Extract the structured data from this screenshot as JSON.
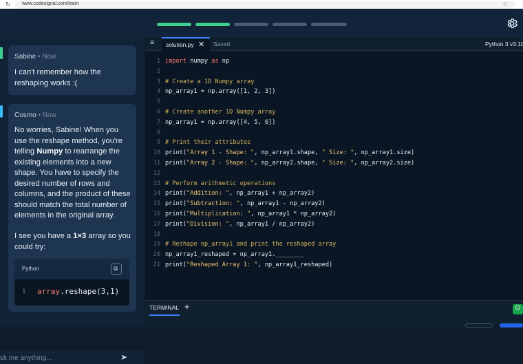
{
  "browser": {
    "url": "www.codesignal.com/learn",
    "reload_icon": "reload-icon",
    "star_icon": "star-icon"
  },
  "header": {
    "progress_segments": [
      {
        "state": "done",
        "color": "#3ecf8e"
      },
      {
        "state": "done",
        "color": "#3ecf8e"
      },
      {
        "state": "todo",
        "color": "#4a5d75"
      },
      {
        "state": "todo",
        "color": "#4a5d75"
      },
      {
        "state": "todo",
        "color": "#4a5d75"
      }
    ],
    "settings_icon": "gear-icon"
  },
  "chat": {
    "messages": [
      {
        "author": "Sabine",
        "sep": "•",
        "time": "Now",
        "accent": "#3ecf8e",
        "text": "I can't remember how the reshaping works :("
      },
      {
        "author": "Cosmo",
        "sep": "•",
        "time": "Now",
        "accent": "#38bdf8",
        "p1_a": "No worries, Sabine! When you use the reshape method, you're telling ",
        "p1_b": "Numpy",
        "p1_c": " to rearrange the existing elements into a new shape. You have to specify the desired number of rows and columns, and the product of these should match the total number of elements in the original array.",
        "p2_a": "I see you have a ",
        "p2_b": "1×3",
        "p2_c": " array so you could try:",
        "code_lang": "Python",
        "code_line_no": "1",
        "code_obj": "array",
        "code_rest": ".reshape(3,1)"
      }
    ],
    "input_placeholder": "sk me anything...",
    "send_icon": "send-icon"
  },
  "editor": {
    "menu_icon": "hamburger-icon",
    "tab_name": "solution.py",
    "close_icon": "close-icon",
    "status": "Saved",
    "language": "Python 3 v3.10",
    "lines": [
      {
        "no": "1",
        "kind": "import",
        "a": "import",
        "b": " numpy ",
        "c": "as",
        "d": " np"
      },
      {
        "no": "2",
        "kind": "blank"
      },
      {
        "no": "3",
        "kind": "comment",
        "text": "# Create a 1D Numpy array"
      },
      {
        "no": "4",
        "kind": "plain",
        "text": "np_array1 = np.array([1, 2, 3])"
      },
      {
        "no": "5",
        "kind": "blank"
      },
      {
        "no": "6",
        "kind": "comment",
        "text": "# Create another 1D Numpy array"
      },
      {
        "no": "7",
        "kind": "plain",
        "text": "np_array1 = np.array([4, 5, 6])"
      },
      {
        "no": "8",
        "kind": "blank"
      },
      {
        "no": "9",
        "kind": "comment",
        "text": "# Print their attributes"
      },
      {
        "no": "10",
        "kind": "print",
        "s": "\"Array 1 - Shape: \"",
        "m": ", np_array1.shape, ",
        "s2": "\" Size: \"",
        "e": ", np_array1.size)"
      },
      {
        "no": "11",
        "kind": "print",
        "s": "\"Array 2 - Shape: \"",
        "m": ", np_array2.shape, ",
        "s2": "\" Size: \"",
        "e": ", np_array2.size)"
      },
      {
        "no": "12",
        "kind": "blank"
      },
      {
        "no": "13",
        "kind": "comment",
        "text": "# Perform arithmetic operations"
      },
      {
        "no": "14",
        "kind": "print",
        "s": "\"Addition: \"",
        "m": ", np_array1 + np_array2)",
        "s2": "",
        "e": ""
      },
      {
        "no": "15",
        "kind": "print",
        "s": "\"Subtraction: \"",
        "m": ", np_array1 - np_array2)",
        "s2": "",
        "e": ""
      },
      {
        "no": "16",
        "kind": "print",
        "s": "\"Multiplication: \"",
        "m": ", np_array1 * np_array2)",
        "s2": "",
        "e": ""
      },
      {
        "no": "17",
        "kind": "print",
        "s": "\"Division: \"",
        "m": ", np_array1 / np_array2)",
        "s2": "",
        "e": ""
      },
      {
        "no": "18",
        "kind": "blank"
      },
      {
        "no": "19",
        "kind": "comment",
        "text": "# Reshape np_array1 and print the reshaped array"
      },
      {
        "no": "20",
        "kind": "plain",
        "text": "np_array1_reshaped = np_array1.________"
      },
      {
        "no": "21",
        "kind": "print",
        "s": "\"Reshaped Array 1: \"",
        "m": ", np_array1_reshaped)",
        "s2": "",
        "e": ""
      }
    ],
    "terminal_label": "TERMINAL",
    "add_terminal_icon": "plus-icon",
    "run_icon": "run-icon"
  }
}
